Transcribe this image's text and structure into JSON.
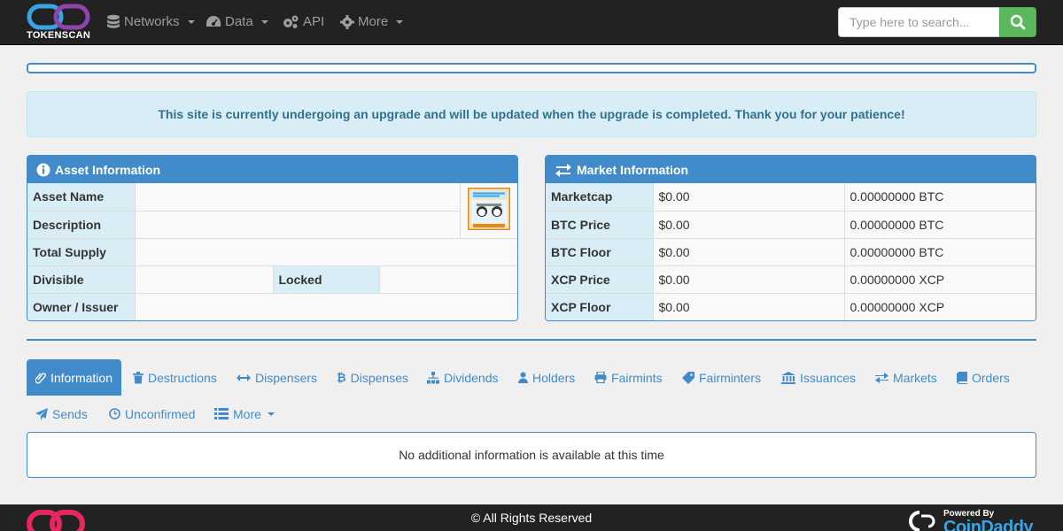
{
  "brand": {
    "name": "TOKENSCAN"
  },
  "nav": {
    "networks": "Networks",
    "data": "Data",
    "api": "API",
    "more": "More"
  },
  "search": {
    "placeholder": "Type here to search..."
  },
  "alert": {
    "text": "This site is currently undergoing an upgrade and will be updated when the upgrade is completed. Thank you for your patience!"
  },
  "asset_panel": {
    "title": "Asset Information",
    "labels": {
      "asset_name": "Asset Name",
      "description": "Description",
      "total_supply": "Total Supply",
      "divisible": "Divisible",
      "locked": "Locked",
      "owner": "Owner / Issuer"
    },
    "values": {
      "asset_name": "",
      "description": "",
      "total_supply": "",
      "divisible": "",
      "locked": "",
      "owner": ""
    }
  },
  "market_panel": {
    "title": "Market Information",
    "rows": [
      {
        "label": "Marketcap",
        "usd": "$0.00",
        "native": "0.00000000 BTC"
      },
      {
        "label": "BTC Price",
        "usd": "$0.00",
        "native": "0.00000000 BTC"
      },
      {
        "label": "BTC Floor",
        "usd": "$0.00",
        "native": "0.00000000 BTC"
      },
      {
        "label": "XCP Price",
        "usd": "$0.00",
        "native": "0.00000000 XCP"
      },
      {
        "label": "XCP Floor",
        "usd": "$0.00",
        "native": "0.00000000 XCP"
      }
    ]
  },
  "tabs": {
    "information": "Information",
    "destructions": "Destructions",
    "dispensers": "Dispensers",
    "dispenses": "Dispenses",
    "dividends": "Dividends",
    "holders": "Holders",
    "fairmints": "Fairmints",
    "fairminters": "Fairminters",
    "issuances": "Issuances",
    "markets": "Markets",
    "orders": "Orders",
    "sends": "Sends",
    "unconfirmed": "Unconfirmed",
    "more": "More"
  },
  "content": {
    "message": "No additional information is available at this time"
  },
  "footer": {
    "copyright": "© All Rights Reserved",
    "powered_by": "Powered By",
    "powered_name": "CoinDaddy"
  },
  "colors": {
    "primary": "#428bca",
    "navbar": "#222222",
    "alert_bg": "#d9edf7",
    "success": "#5cb85c"
  }
}
